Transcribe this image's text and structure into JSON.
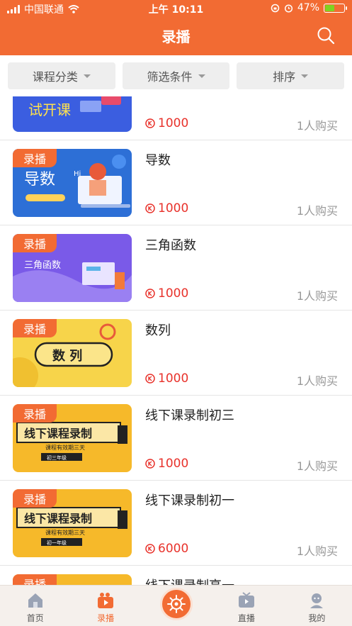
{
  "status_bar": {
    "carrier": "中国联通",
    "time": "上午 10:11",
    "battery": "47%"
  },
  "header": {
    "title": "录播"
  },
  "filters": [
    {
      "label": "课程分类"
    },
    {
      "label": "筛选条件"
    },
    {
      "label": "排序"
    }
  ],
  "courses": [
    {
      "tag": "",
      "title": "",
      "price": "1000",
      "buyers": "1人购买",
      "thumb_text": "试开课"
    },
    {
      "tag": "录播",
      "title": "导数",
      "price": "1000",
      "buyers": "1人购买",
      "thumb_text": "导数"
    },
    {
      "tag": "录播",
      "title": "三角函数",
      "price": "1000",
      "buyers": "1人购买",
      "thumb_text": "三角函数"
    },
    {
      "tag": "录播",
      "title": "数列",
      "price": "1000",
      "buyers": "1人购买",
      "thumb_text": "数 列"
    },
    {
      "tag": "录播",
      "title": "线下课录制初三",
      "price": "1000",
      "buyers": "1人购买",
      "thumb_text": "线下课程录制",
      "thumb_sub": "课程有效期三天",
      "thumb_grade": "初三年级"
    },
    {
      "tag": "录播",
      "title": "线下课录制初一",
      "price": "6000",
      "buyers": "1人购买",
      "thumb_text": "线下课程录制",
      "thumb_sub": "课程有效期三天",
      "thumb_grade": "初一年级"
    },
    {
      "tag": "录播",
      "title": "线下课录制高一",
      "price": "",
      "buyers": "",
      "thumb_text": ""
    }
  ],
  "tabbar": [
    {
      "label": "首页",
      "icon": "home-icon"
    },
    {
      "label": "录播",
      "icon": "video-icon"
    },
    {
      "label": "",
      "icon": "helm-icon"
    },
    {
      "label": "直播",
      "icon": "tv-icon"
    },
    {
      "label": "我的",
      "icon": "user-icon"
    }
  ],
  "colors": {
    "accent": "#f26b33",
    "price": "#e8322b",
    "muted": "#999999"
  }
}
